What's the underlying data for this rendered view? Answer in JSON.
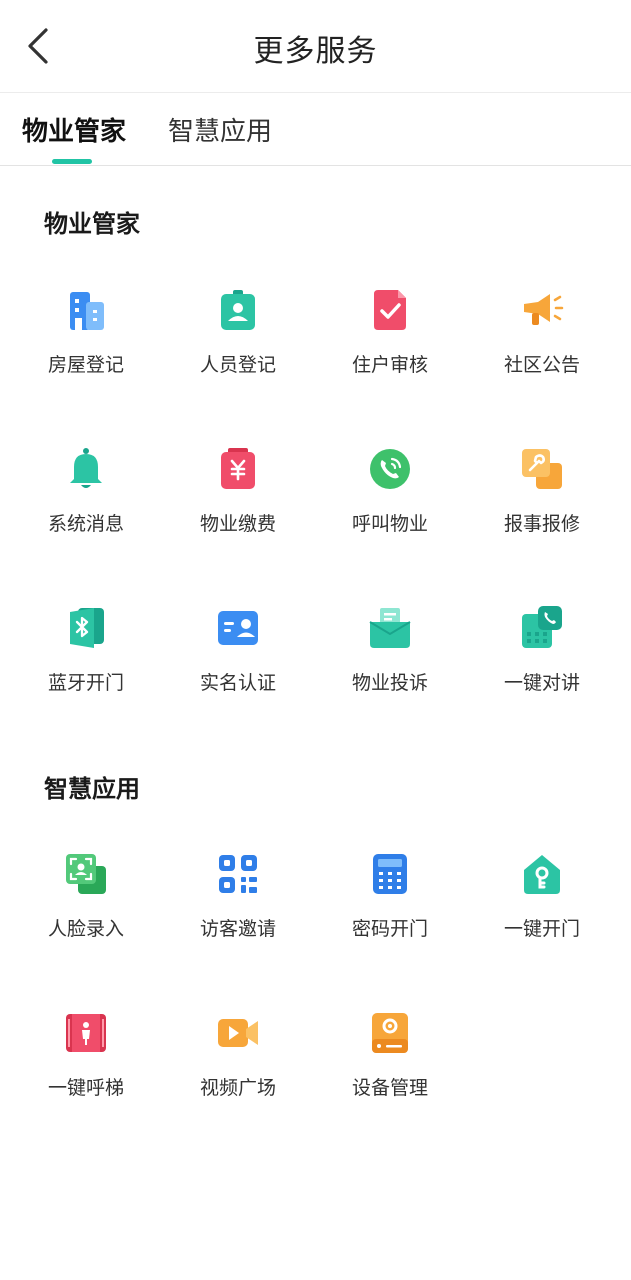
{
  "header": {
    "title": "更多服务",
    "back_icon": "chevron-left-icon"
  },
  "tabs": [
    {
      "label": "物业管家",
      "active": true
    },
    {
      "label": "智慧应用",
      "active": false
    }
  ],
  "accent_color": "#21c4a5",
  "sections": [
    {
      "title": "物业管家",
      "items": [
        {
          "label": "房屋登记",
          "icon": "building-icon"
        },
        {
          "label": "人员登记",
          "icon": "id-badge-icon"
        },
        {
          "label": "住户审核",
          "icon": "document-check-icon"
        },
        {
          "label": "社区公告",
          "icon": "megaphone-icon"
        },
        {
          "label": "系统消息",
          "icon": "bell-icon"
        },
        {
          "label": "物业缴费",
          "icon": "payment-yen-icon"
        },
        {
          "label": "呼叫物业",
          "icon": "phone-call-icon"
        },
        {
          "label": "报事报修",
          "icon": "wrench-icon"
        },
        {
          "label": "蓝牙开门",
          "icon": "bluetooth-door-icon"
        },
        {
          "label": "实名认证",
          "icon": "id-card-icon"
        },
        {
          "label": "物业投诉",
          "icon": "complaint-inbox-icon"
        },
        {
          "label": "一键对讲",
          "icon": "intercom-icon"
        }
      ]
    },
    {
      "title": "智慧应用",
      "items": [
        {
          "label": "人脸录入",
          "icon": "face-scan-icon"
        },
        {
          "label": "访客邀请",
          "icon": "qr-code-icon"
        },
        {
          "label": "密码开门",
          "icon": "keypad-icon"
        },
        {
          "label": "一键开门",
          "icon": "home-key-icon"
        },
        {
          "label": "一键呼梯",
          "icon": "elevator-icon"
        },
        {
          "label": "视频广场",
          "icon": "video-camera-icon"
        },
        {
          "label": "设备管理",
          "icon": "device-settings-icon"
        }
      ]
    }
  ]
}
